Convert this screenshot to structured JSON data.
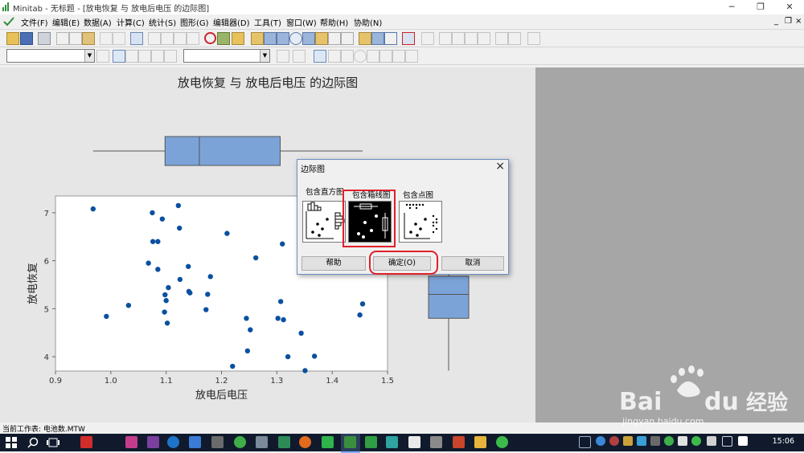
{
  "window": {
    "app_name": "Minitab",
    "title": "Minitab - 无标题 - [放电恢复 与 放电后电压 的边际图]"
  },
  "menubar": {
    "items": [
      "文件(F)",
      "编辑(E)",
      "数据(A)",
      "计算(C)",
      "统计(S)",
      "图形(G)",
      "编辑器(D)",
      "工具(T)",
      "窗口(W)",
      "帮助(H)",
      "协助(N)"
    ]
  },
  "workspace": {
    "status_text": "当前工作表: 电池数.MTW"
  },
  "chart_data": {
    "type": "scatter",
    "title": "放电恢复 与 放电后电压 的边际图",
    "xlabel": "放电后电压",
    "ylabel": "放电恢复",
    "xlim": [
      0.9,
      1.5
    ],
    "ylim": [
      3.7,
      7.35
    ],
    "x_ticks": [
      "0.9",
      "1.0",
      "1.1",
      "1.2",
      "1.3",
      "1.4",
      "1.5"
    ],
    "y_ticks": [
      "4",
      "5",
      "6",
      "7"
    ],
    "point_color": "#0a50a0",
    "box_color": "#7ba3d8",
    "points": [
      [
        0.968,
        7.08
      ],
      [
        0.992,
        4.84
      ],
      [
        1.032,
        5.07
      ],
      [
        1.068,
        5.95
      ],
      [
        1.075,
        7.0
      ],
      [
        1.076,
        6.4
      ],
      [
        1.085,
        6.4
      ],
      [
        1.085,
        5.82
      ],
      [
        1.093,
        6.87
      ],
      [
        1.097,
        4.93
      ],
      [
        1.098,
        5.29
      ],
      [
        1.1,
        5.17
      ],
      [
        1.102,
        4.7
      ],
      [
        1.104,
        5.44
      ],
      [
        1.122,
        7.15
      ],
      [
        1.124,
        6.68
      ],
      [
        1.125,
        5.61
      ],
      [
        1.14,
        5.88
      ],
      [
        1.141,
        5.36
      ],
      [
        1.143,
        5.33
      ],
      [
        1.172,
        4.98
      ],
      [
        1.175,
        5.3
      ],
      [
        1.18,
        5.67
      ],
      [
        1.21,
        6.57
      ],
      [
        1.22,
        3.8
      ],
      [
        1.245,
        4.8
      ],
      [
        1.247,
        4.12
      ],
      [
        1.252,
        4.56
      ],
      [
        1.262,
        6.06
      ],
      [
        1.302,
        4.8
      ],
      [
        1.307,
        5.15
      ],
      [
        1.31,
        6.35
      ],
      [
        1.312,
        4.77
      ],
      [
        1.32,
        4.0
      ],
      [
        1.344,
        4.49
      ],
      [
        1.351,
        3.71
      ],
      [
        1.368,
        4.01
      ],
      [
        1.45,
        4.87
      ],
      [
        1.455,
        5.1
      ]
    ],
    "x_box": {
      "min": 0.968,
      "q1": 1.098,
      "median": 1.16,
      "q3": 1.306,
      "max": 1.455
    },
    "y_box": {
      "min": 3.71,
      "q1": 4.8,
      "median": 5.3,
      "q3": 5.68,
      "max": 7.15
    }
  },
  "dialog": {
    "title": "边际图",
    "options": [
      {
        "label": "包含直方图",
        "highlighted": false
      },
      {
        "label": "包含箱线图",
        "highlighted": true
      },
      {
        "label": "包含点图",
        "highlighted": false
      }
    ],
    "buttons": {
      "help": "帮助",
      "ok": "确定(O)",
      "cancel": "取消"
    },
    "ok_highlighted": true
  },
  "taskbar": {
    "time": "15:06"
  },
  "watermark": {
    "brand_left": "Bai",
    "brand_right": "du",
    "brand_cn": "经验",
    "url": "jingyan.baidu.com"
  },
  "colors": {
    "highlight": "#e0202a",
    "taskbar": "#101a2c",
    "right_pane": "#a6a6a6"
  }
}
